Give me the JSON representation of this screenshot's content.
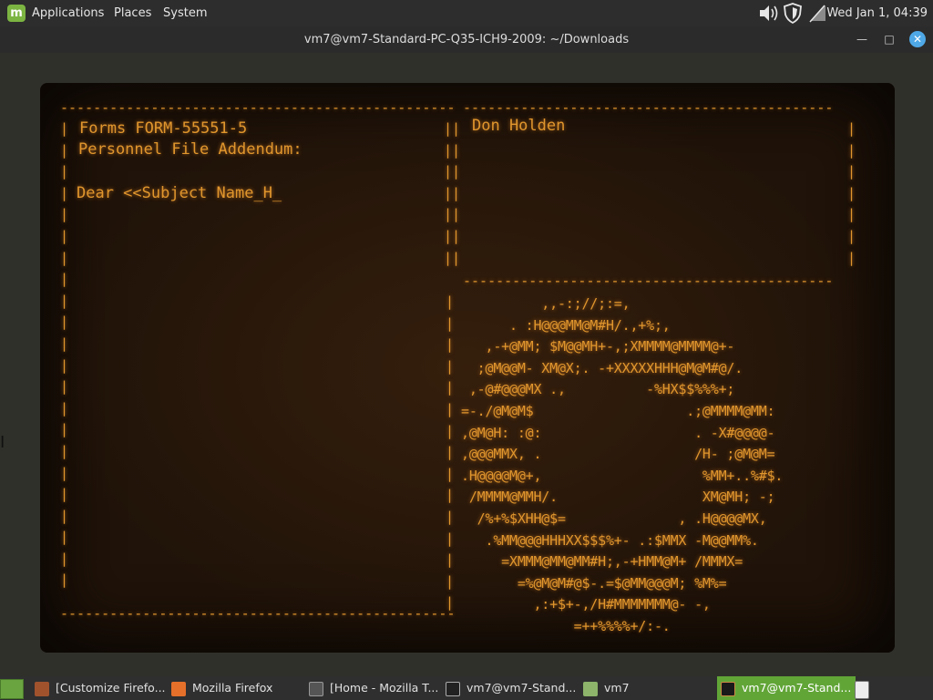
{
  "top_panel": {
    "menu": [
      "Applications",
      "Places",
      "System"
    ],
    "clock": "Wed Jan  1, 04:39",
    "tray_icons": [
      "volume-icon",
      "shield-icon",
      "network-icon"
    ]
  },
  "window": {
    "title": "vm7@vm7-Standard-PC-Q35-ICH9-2009: ~/Downloads",
    "controls": [
      "minimize",
      "maximize",
      "close"
    ]
  },
  "terminal": {
    "border_top_left": "------------------------------------------------",
    "border_top_right": "---------------------------------------------",
    "left_panel": {
      "form_line": "Forms FORM-55551-5",
      "subtitle": "Personnel File Addendum:",
      "greeting": "Dear <<Subject Name_H_"
    },
    "right_panel": {
      "name": "Don Holden"
    },
    "ascii_art": [
      "          ,,-:;//;:=,",
      "      . :H@@@MM@M#H/.,+%;,",
      "   ,-+@MM; $M@@MH+-,;XMMMM@MMMM@+-",
      "  ;@M@@M- XM@X;. -+XXXXXHHH@M@M#@/.",
      " ,-@#@@@MX .,          -%HX$$%%%+;",
      "=-./@M@M$                   .;@MMMM@MM:",
      ",@M@H: :@:                   . -X#@@@@-",
      ",@@@MMX, .                   /H- ;@M@M=",
      ".H@@@@M@+,                    %MM+..%#$.",
      " /MMMM@MMH/.                  XM@MH; -;",
      "  /%+%$XHH@$=              , .H@@@@MX,",
      "   .%MM@@@HHHXX$$$%+- .:$MMX -M@@MM%.",
      "     =XMMM@MM@MM#H;,-+HMM@M+ /MMMX=",
      "       =%@M@M#@$-.=$@MM@@@M; %M%=",
      "         ,:+$+-,/H#MMMMMMM@- -,",
      "              =++%%%%+/:-."
    ]
  },
  "taskbar": {
    "items": [
      {
        "label": "[Customize Firefo...",
        "icon": "firefox-icon",
        "active": false
      },
      {
        "label": "Mozilla Firefox",
        "icon": "firefox-icon",
        "active": false
      },
      {
        "label": "[Home - Mozilla T...",
        "icon": "thunderbird-icon",
        "active": false
      },
      {
        "label": "vm7@vm7-Stand...",
        "icon": "terminal-icon",
        "active": false
      },
      {
        "label": "vm7",
        "icon": "folder-icon",
        "active": false
      },
      {
        "label": "vm7@vm7-Stand...",
        "icon": "terminal-icon",
        "active": true
      }
    ]
  },
  "colors": {
    "phosphor": "#e0962d",
    "crt_bg": "#201309",
    "mint_green": "#7cb442",
    "active_task": "#61a537"
  }
}
